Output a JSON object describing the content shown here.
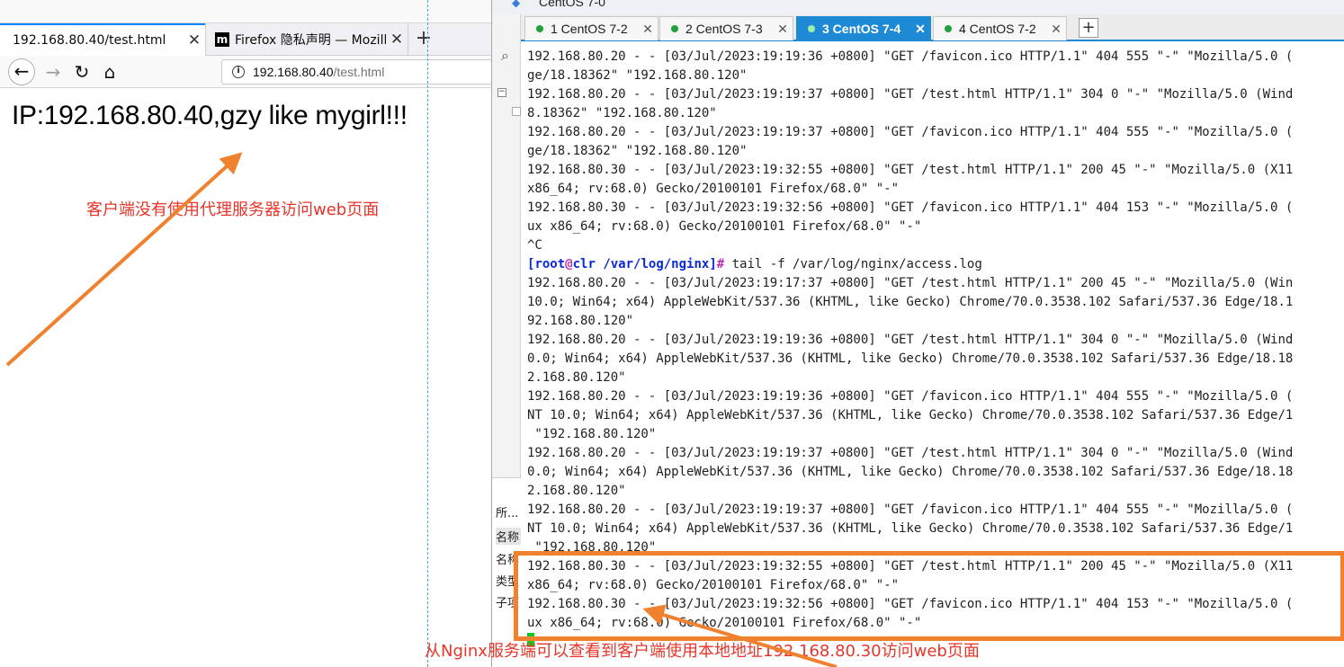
{
  "firefox": {
    "tabs": [
      {
        "label": "192.168.80.40/test.html",
        "active": true
      },
      {
        "label": "Firefox 隐私声明 — Mozilla",
        "favicon": "m"
      }
    ],
    "url": {
      "host": "192.168.80.40",
      "path": "/test.html"
    },
    "page_heading": "IP:192.168.80.40,gzy like mygirl!!!",
    "annotation": "客户端没有使用代理服务器访问web页面"
  },
  "xshell": {
    "window_title": "CentOS 7-0",
    "tabs": [
      {
        "label": "1 CentOS 7-2",
        "active": false
      },
      {
        "label": "2 CentOS 7-3",
        "active": false
      },
      {
        "label": "3 CentOS 7-4",
        "active": true
      },
      {
        "label": "4 CentOS 7-2",
        "active": false
      }
    ],
    "side_panel": {
      "header": "所...",
      "rows": [
        "名称",
        "名称",
        "类型",
        "子项"
      ]
    },
    "terminal": {
      "prompt": {
        "user": "root",
        "host": "clr",
        "dir": "/var/log/nginx",
        "command": " tail -f /var/log/nginx/access.log"
      },
      "lines": [
        "192.168.80.20 - - [03/Jul/2023:19:19:36 +0800] \"GET /favicon.ico HTTP/1.1\" 404 555 \"-\" \"Mozilla/5.0 (",
        "ge/18.18362\" \"192.168.80.120\"",
        "192.168.80.20 - - [03/Jul/2023:19:19:37 +0800] \"GET /test.html HTTP/1.1\" 304 0 \"-\" \"Mozilla/5.0 (Wind",
        "8.18362\" \"192.168.80.120\"",
        "192.168.80.20 - - [03/Jul/2023:19:19:37 +0800] \"GET /favicon.ico HTTP/1.1\" 404 555 \"-\" \"Mozilla/5.0 (",
        "ge/18.18362\" \"192.168.80.120\"",
        "192.168.80.30 - - [03/Jul/2023:19:32:55 +0800] \"GET /test.html HTTP/1.1\" 200 45 \"-\" \"Mozilla/5.0 (X11",
        "x86_64; rv:68.0) Gecko/20100101 Firefox/68.0\" \"-\"",
        "192.168.80.30 - - [03/Jul/2023:19:32:56 +0800] \"GET /favicon.ico HTTP/1.1\" 404 153 \"-\" \"Mozilla/5.0 (",
        "ux x86_64; rv:68.0) Gecko/20100101 Firefox/68.0\" \"-\"",
        "^C",
        "__PROMPT__",
        "192.168.80.20 - - [03/Jul/2023:19:17:37 +0800] \"GET /test.html HTTP/1.1\" 200 45 \"-\" \"Mozilla/5.0 (Win",
        "10.0; Win64; x64) AppleWebKit/537.36 (KHTML, like Gecko) Chrome/70.0.3538.102 Safari/537.36 Edge/18.1",
        "92.168.80.120\"",
        "192.168.80.20 - - [03/Jul/2023:19:19:36 +0800] \"GET /test.html HTTP/1.1\" 304 0 \"-\" \"Mozilla/5.0 (Wind",
        "0.0; Win64; x64) AppleWebKit/537.36 (KHTML, like Gecko) Chrome/70.0.3538.102 Safari/537.36 Edge/18.18",
        "2.168.80.120\"",
        "192.168.80.20 - - [03/Jul/2023:19:19:36 +0800] \"GET /favicon.ico HTTP/1.1\" 404 555 \"-\" \"Mozilla/5.0 (",
        "NT 10.0; Win64; x64) AppleWebKit/537.36 (KHTML, like Gecko) Chrome/70.0.3538.102 Safari/537.36 Edge/1",
        " \"192.168.80.120\"",
        "192.168.80.20 - - [03/Jul/2023:19:19:37 +0800] \"GET /test.html HTTP/1.1\" 304 0 \"-\" \"Mozilla/5.0 (Wind",
        "0.0; Win64; x64) AppleWebKit/537.36 (KHTML, like Gecko) Chrome/70.0.3538.102 Safari/537.36 Edge/18.18",
        "2.168.80.120\"",
        "192.168.80.20 - - [03/Jul/2023:19:19:37 +0800] \"GET /favicon.ico HTTP/1.1\" 404 555 \"-\" \"Mozilla/5.0 (",
        "NT 10.0; Win64; x64) AppleWebKit/537.36 (KHTML, like Gecko) Chrome/70.0.3538.102 Safari/537.36 Edge/1",
        " \"192.168.80.120\"",
        "192.168.80.30 - - [03/Jul/2023:19:32:55 +0800] \"GET /test.html HTTP/1.1\" 200 45 \"-\" \"Mozilla/5.0 (X11",
        "x86_64; rv:68.0) Gecko/20100101 Firefox/68.0\" \"-\"",
        "192.168.80.30 - - [03/Jul/2023:19:32:56 +0800] \"GET /favicon.ico HTTP/1.1\" 404 153 \"-\" \"Mozilla/5.0 (",
        "ux x86_64; rv:68.0) Gecko/20100101 Firefox/68.0\" \"-\""
      ]
    },
    "annotation": "从Nginx服务端可以查看到客户端使用本地地址192.168.80.30访问web页面"
  },
  "colors": {
    "accent": "#1e8ad6",
    "annotation_text": "#e8352a",
    "arrow": "#f0812e",
    "highlight_box": "#f0812e"
  }
}
